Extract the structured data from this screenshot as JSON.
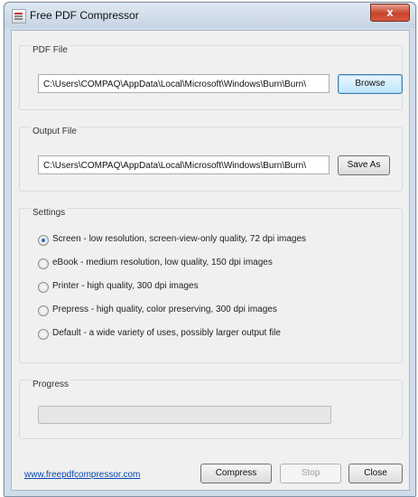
{
  "window": {
    "title": "Free PDF Compressor",
    "close_label": "x"
  },
  "pdf_file": {
    "group_label": "PDF File",
    "path": "C:\\Users\\COMPAQ\\AppData\\Local\\Microsoft\\Windows\\Burn\\Burn\\",
    "button_label": "Browse"
  },
  "output_file": {
    "group_label": "Output File",
    "path": "C:\\Users\\COMPAQ\\AppData\\Local\\Microsoft\\Windows\\Burn\\Burn\\",
    "button_label": "Save As"
  },
  "settings": {
    "group_label": "Settings",
    "selected_index": 0,
    "options": [
      "Screen - low resolution, screen-view-only quality, 72 dpi images",
      "eBook - medium resolution, low quality, 150 dpi images",
      "Printer - high quality, 300 dpi images",
      "Prepress - high quality, color preserving, 300 dpi images",
      "Default - a wide variety of uses, possibly larger output file"
    ]
  },
  "progress": {
    "group_label": "Progress",
    "value": 0
  },
  "footer": {
    "link_text": "www.freepdfcompressor.com",
    "compress_label": "Compress",
    "stop_label": "Stop",
    "close_label": "Close"
  },
  "colors": {
    "link": "#0645ad",
    "radio_selected": "#2b6cc4",
    "progress_fill": "#06b025"
  }
}
